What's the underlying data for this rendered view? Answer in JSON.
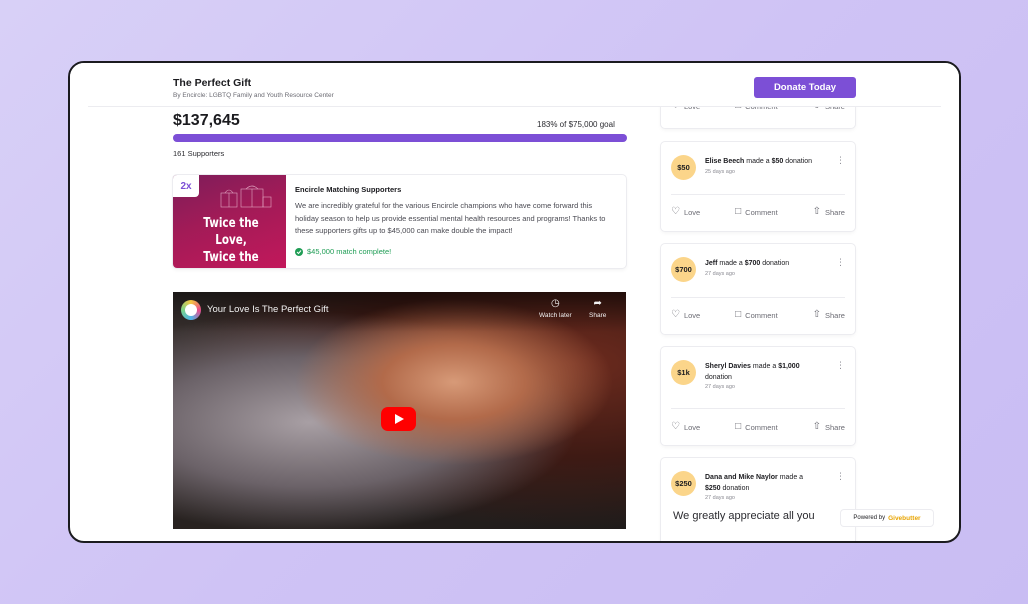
{
  "header": {
    "title": "The Perfect Gift",
    "subtitle": "By Encircle: LGBTQ Family and Youth Resource Center",
    "donate_label": "Donate Today"
  },
  "campaign": {
    "amount_raised": "$137,645",
    "goal_text": "183% of $75,000 goal",
    "progress_percent": 100,
    "supporters": "161 Supporters"
  },
  "match": {
    "badge": "2x",
    "image_line1": "Twice the Love,",
    "image_line2": "Twice the Impact!",
    "title": "Encircle Matching Supporters",
    "description": "We are incredibly grateful for the various Encircle champions who have come forward this holiday season to help us provide essential mental health resources and programs! Thanks to these supporters gifts up to $45,000 can make double the impact!",
    "status": "$45,000 match complete!"
  },
  "video": {
    "title": "Your Love Is The Perfect Gift",
    "watch_later": "Watch later",
    "share": "Share"
  },
  "actions": {
    "love": "Love",
    "comment": "Comment",
    "share": "Share"
  },
  "feed": [
    {
      "avatar": "$50",
      "name": "Elise Beech",
      "verb": "made a",
      "amount": "$50",
      "suffix": "donation",
      "ago": "25 days ago"
    },
    {
      "avatar": "$700",
      "name": "Jeff",
      "verb": "made a",
      "amount": "$700",
      "suffix": "donation",
      "ago": "27 days ago"
    },
    {
      "avatar": "$1k",
      "name": "Sheryl Davies",
      "verb": "made a",
      "amount": "$1,000",
      "suffix": "donation",
      "ago": "27 days ago"
    },
    {
      "avatar": "$250",
      "name": "Dana and Mike Naylor",
      "verb": "made a",
      "amount": "$250",
      "suffix": "donation",
      "ago": "27 days ago",
      "message": "We greatly appreciate all you"
    }
  ],
  "powered_by": {
    "prefix": "Powered by",
    "brand": "Givebutter"
  },
  "colors": {
    "accent": "#7c4fd6",
    "success": "#1f9d55",
    "avatar_bg": "#fbd58a",
    "youtube_red": "#ff0000"
  }
}
